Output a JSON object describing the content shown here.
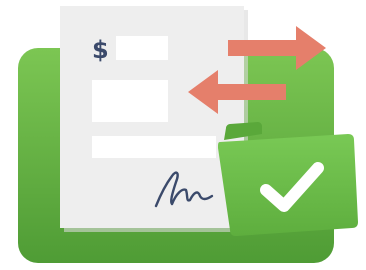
{
  "illustration": {
    "currency_symbol": "$",
    "colors": {
      "background": "#ffffff",
      "green_panel": "#6ab84a",
      "green_panel_dark": "#4e9a34",
      "document": "#ededed",
      "document_shadow": "#dcdcdc",
      "document_field": "#ffffff",
      "arrow": "#e57f6b",
      "folder": "#6cbf47",
      "folder_dark": "#5aa83a",
      "checkmark": "#ffffff",
      "ink": "#3b4a6b"
    },
    "icons": [
      "invoice-document-icon",
      "exchange-arrows-icon",
      "approved-folder-icon",
      "checkmark-icon",
      "signature-icon"
    ]
  }
}
